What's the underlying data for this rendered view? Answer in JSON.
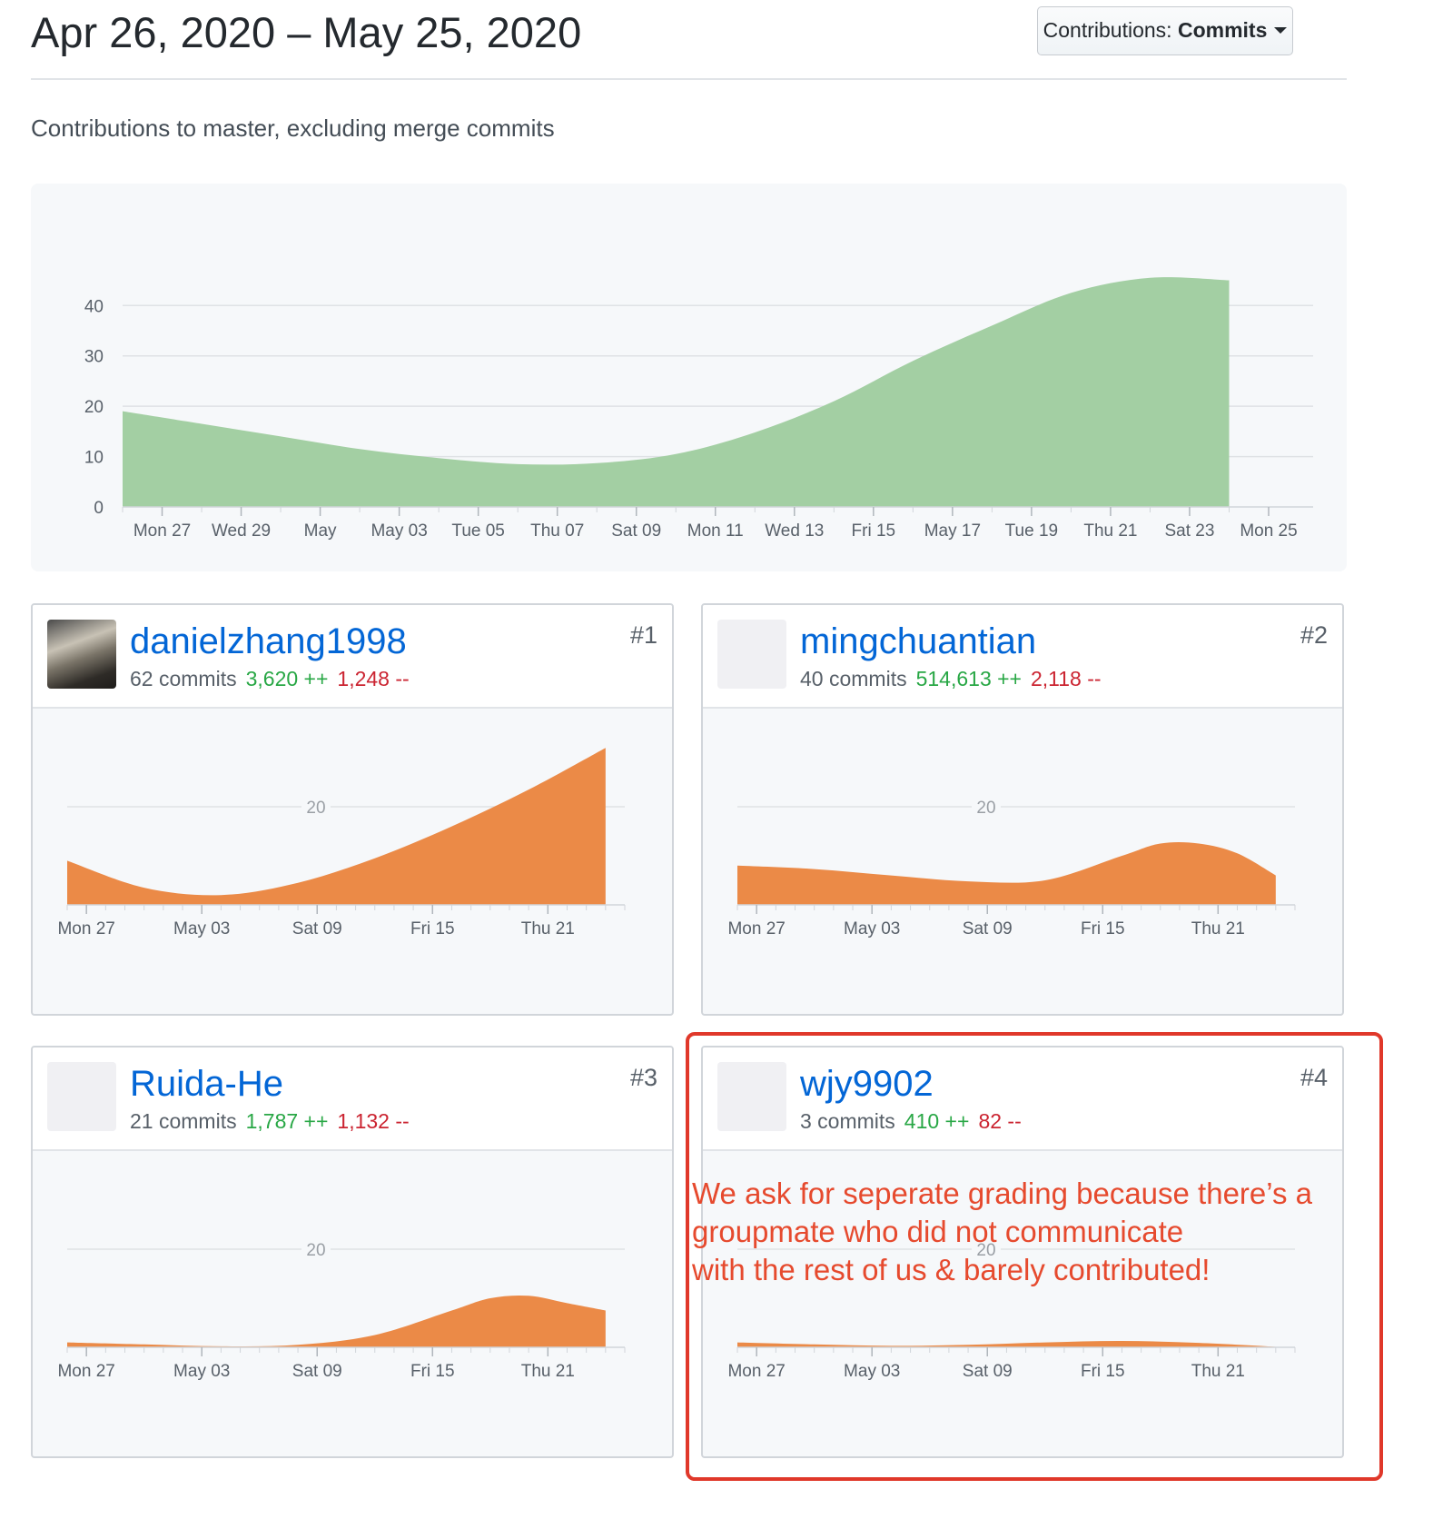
{
  "header": {
    "date_range": "Apr 26, 2020 – May 25, 2020",
    "contributions_prefix": "Contributions:",
    "contributions_value": "Commits"
  },
  "subtitle": "Contributions to master, excluding merge commits",
  "colors": {
    "main_area": "#a3cfa3",
    "user_area": "#eb8a47",
    "link": "#0366d6",
    "adds": "#28a745",
    "dels": "#cb2431",
    "annotation": "#e64a2e"
  },
  "chart_data": [
    {
      "type": "area",
      "ylim": [
        0,
        46
      ],
      "yticks": [
        0,
        10,
        20,
        30,
        40
      ],
      "x_tick_labels": [
        "Mon 27",
        "Wed 29",
        "May",
        "May 03",
        "Tue 05",
        "Thu 07",
        "Sat 09",
        "Mon 11",
        "Wed 13",
        "Fri 15",
        "May 17",
        "Tue 19",
        "Thu 21",
        "Sat 23",
        "Mon 25"
      ],
      "x": [
        0,
        2,
        4,
        6,
        8,
        10,
        12,
        14,
        16,
        18,
        20,
        22,
        24,
        26,
        28
      ],
      "series": [
        {
          "values": [
            19,
            16.5,
            14,
            11.5,
            9.7,
            8.5,
            8.7,
            10.5,
            14.8,
            21,
            29,
            36,
            42.5,
            45.5,
            45
          ]
        }
      ],
      "x_max": 29
    },
    {
      "type": "area",
      "ylim": [
        0,
        30
      ],
      "yticks": [
        20
      ],
      "x_tick_labels": [
        "Mon 27",
        "May 03",
        "Sat 09",
        "Fri 15",
        "Thu 21"
      ],
      "x_ticks": [
        1,
        7,
        13,
        19,
        25
      ],
      "x": [
        0,
        4,
        8,
        12,
        16,
        20,
        24,
        28
      ],
      "series": [
        {
          "values": [
            9,
            3.5,
            2,
            4.5,
            9.5,
            16,
            23.5,
            32
          ]
        }
      ],
      "x_max": 29
    },
    {
      "type": "area",
      "ylim": [
        0,
        30
      ],
      "yticks": [
        20
      ],
      "x_tick_labels": [
        "Mon 27",
        "May 03",
        "Sat 09",
        "Fri 15",
        "Thu 21"
      ],
      "x_ticks": [
        1,
        7,
        13,
        19,
        25
      ],
      "x": [
        0,
        4,
        8,
        12,
        16,
        20,
        22,
        24,
        26,
        28
      ],
      "series": [
        {
          "values": [
            8,
            7.3,
            6,
            4.8,
            5,
            10,
            12.5,
            12.5,
            10.5,
            6
          ]
        }
      ],
      "x_max": 29
    },
    {
      "type": "area",
      "ylim": [
        0,
        30
      ],
      "yticks": [
        20
      ],
      "x_tick_labels": [
        "Mon 27",
        "May 03",
        "Sat 09",
        "Fri 15",
        "Thu 21"
      ],
      "x_ticks": [
        1,
        7,
        13,
        19,
        25
      ],
      "x": [
        0,
        4,
        8,
        12,
        16,
        20,
        22,
        24,
        26,
        28
      ],
      "series": [
        {
          "values": [
            1,
            0.6,
            0.2,
            0.5,
            2.5,
            7.5,
            10,
            10.5,
            9,
            7.5
          ]
        }
      ],
      "x_max": 29
    },
    {
      "type": "area",
      "ylim": [
        0,
        30
      ],
      "yticks": [
        20
      ],
      "x_tick_labels": [
        "Mon 27",
        "May 03",
        "Sat 09",
        "Fri 15",
        "Thu 21"
      ],
      "x_ticks": [
        1,
        7,
        13,
        19,
        25
      ],
      "x": [
        0,
        4,
        8,
        12,
        16,
        20,
        24,
        28
      ],
      "series": [
        {
          "values": [
            1,
            0.6,
            0.3,
            0.5,
            1,
            1.3,
            0.9,
            0.1
          ]
        }
      ],
      "x_max": 29
    }
  ],
  "users": [
    {
      "name": "danielzhang1998",
      "commits": "62 commits",
      "adds": "3,620 ++",
      "dels": "1,248 --",
      "rank": "#1"
    },
    {
      "name": "mingchuantian",
      "commits": "40 commits",
      "adds": "514,613 ++",
      "dels": "2,118 --",
      "rank": "#2"
    },
    {
      "name": "Ruida-He",
      "commits": "21 commits",
      "adds": "1,787 ++",
      "dels": "1,132 --",
      "rank": "#3"
    },
    {
      "name": "wjy9902",
      "commits": "3 commits",
      "adds": "410 ++",
      "dels": "82 --",
      "rank": "#4"
    }
  ],
  "annotation": {
    "lines": [
      "We ask for seperate grading because there’s a",
      "groupmate who did not communicate",
      "with the rest of us & barely contributed!"
    ]
  }
}
